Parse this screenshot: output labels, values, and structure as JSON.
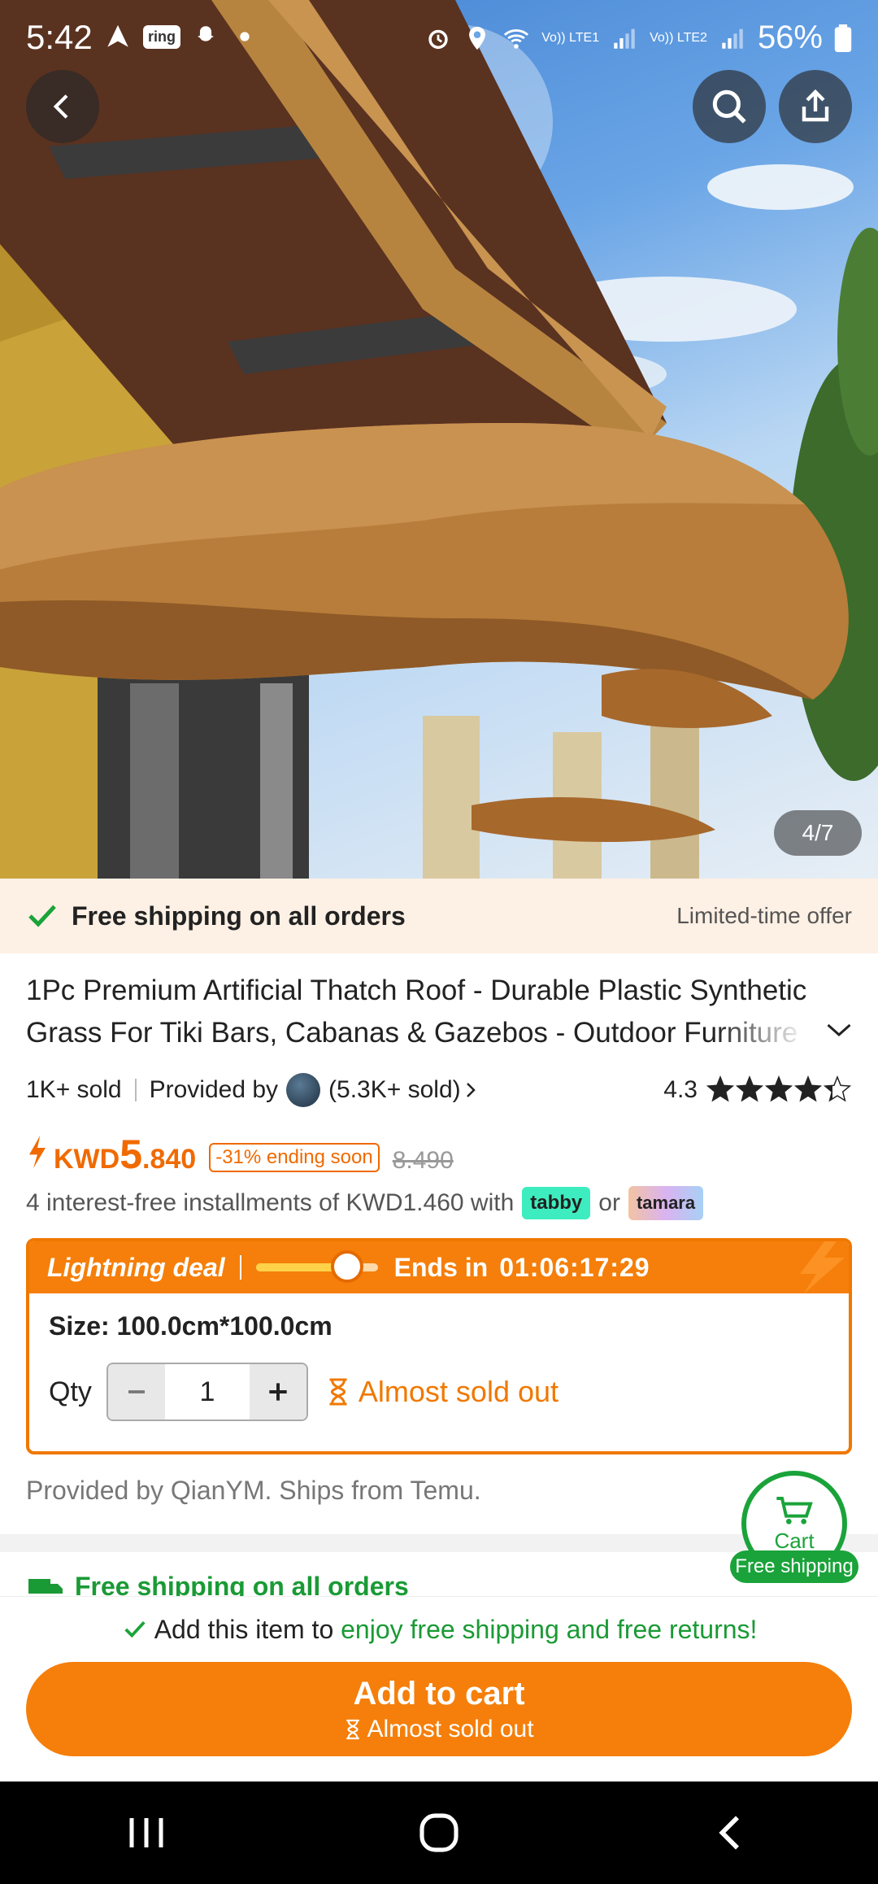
{
  "status_bar": {
    "time": "5:42",
    "ring_badge": "ring",
    "network_1": "Vo)) LTE1",
    "network_2": "Vo)) LTE2",
    "battery": "56%"
  },
  "gallery": {
    "counter": "4/7"
  },
  "shipping_banner": {
    "text": "Free shipping on all orders",
    "offer": "Limited-time offer"
  },
  "product": {
    "title": "1Pc Premium Artificial Thatch Roof - Durable Plastic Synthetic Grass For Tiki Bars, Cabanas & Gazebos - Outdoor Furniture",
    "sold": "1K+ sold",
    "provided_by_label": "Provided by",
    "store_sold": "(5.3K+ sold)",
    "rating": "4.3",
    "rating_value": 4.3,
    "currency": "KWD",
    "price_int": "5",
    "price_dec": ".840",
    "discount": "-31% ending soon",
    "original_price": "8.490",
    "installments_text": "4 interest-free installments of KWD1.460 with",
    "tabby": "tabby",
    "or": "or",
    "tamara": "tamara"
  },
  "deal": {
    "label": "Lightning deal",
    "progress": 0.75,
    "ends_label": "Ends in",
    "timer": "01:06:17:29",
    "size": "Size: 100.0cm*100.0cm",
    "qty_label": "Qty",
    "qty_value": "1",
    "stock_status": "Almost sold out"
  },
  "provided_line": "Provided by QianYM. Ships from Temu.",
  "cart_button": {
    "label": "Cart",
    "pill": "Free shipping"
  },
  "next_section": {
    "text": "Free shipping on all orders"
  },
  "bottom": {
    "promo_prefix": "Add this item to",
    "promo_green": "enjoy free shipping and free returns!",
    "add_to_cart": "Add to cart",
    "add_to_cart_sub": "Almost sold out"
  },
  "colors": {
    "accent": "#f57f0a",
    "green": "#1aa33a",
    "banner_bg": "#fdf0e4"
  }
}
